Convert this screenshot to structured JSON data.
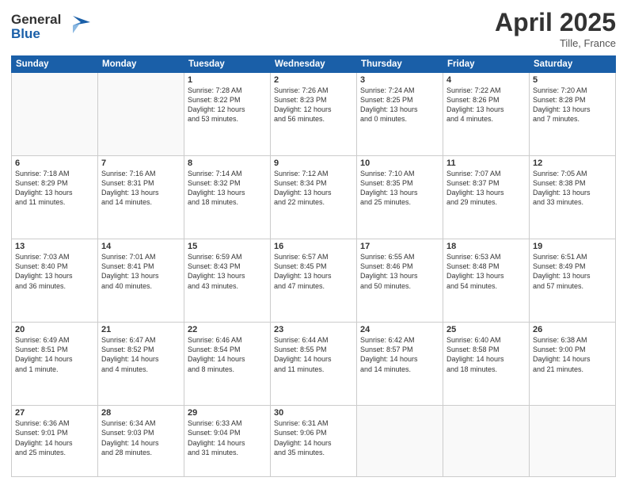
{
  "header": {
    "logo_line1": "General",
    "logo_line2": "Blue",
    "title": "April 2025",
    "location": "Tille, France"
  },
  "columns": [
    "Sunday",
    "Monday",
    "Tuesday",
    "Wednesday",
    "Thursday",
    "Friday",
    "Saturday"
  ],
  "weeks": [
    [
      {
        "day": "",
        "info": ""
      },
      {
        "day": "",
        "info": ""
      },
      {
        "day": "1",
        "info": "Sunrise: 7:28 AM\nSunset: 8:22 PM\nDaylight: 12 hours\nand 53 minutes."
      },
      {
        "day": "2",
        "info": "Sunrise: 7:26 AM\nSunset: 8:23 PM\nDaylight: 12 hours\nand 56 minutes."
      },
      {
        "day": "3",
        "info": "Sunrise: 7:24 AM\nSunset: 8:25 PM\nDaylight: 13 hours\nand 0 minutes."
      },
      {
        "day": "4",
        "info": "Sunrise: 7:22 AM\nSunset: 8:26 PM\nDaylight: 13 hours\nand 4 minutes."
      },
      {
        "day": "5",
        "info": "Sunrise: 7:20 AM\nSunset: 8:28 PM\nDaylight: 13 hours\nand 7 minutes."
      }
    ],
    [
      {
        "day": "6",
        "info": "Sunrise: 7:18 AM\nSunset: 8:29 PM\nDaylight: 13 hours\nand 11 minutes."
      },
      {
        "day": "7",
        "info": "Sunrise: 7:16 AM\nSunset: 8:31 PM\nDaylight: 13 hours\nand 14 minutes."
      },
      {
        "day": "8",
        "info": "Sunrise: 7:14 AM\nSunset: 8:32 PM\nDaylight: 13 hours\nand 18 minutes."
      },
      {
        "day": "9",
        "info": "Sunrise: 7:12 AM\nSunset: 8:34 PM\nDaylight: 13 hours\nand 22 minutes."
      },
      {
        "day": "10",
        "info": "Sunrise: 7:10 AM\nSunset: 8:35 PM\nDaylight: 13 hours\nand 25 minutes."
      },
      {
        "day": "11",
        "info": "Sunrise: 7:07 AM\nSunset: 8:37 PM\nDaylight: 13 hours\nand 29 minutes."
      },
      {
        "day": "12",
        "info": "Sunrise: 7:05 AM\nSunset: 8:38 PM\nDaylight: 13 hours\nand 33 minutes."
      }
    ],
    [
      {
        "day": "13",
        "info": "Sunrise: 7:03 AM\nSunset: 8:40 PM\nDaylight: 13 hours\nand 36 minutes."
      },
      {
        "day": "14",
        "info": "Sunrise: 7:01 AM\nSunset: 8:41 PM\nDaylight: 13 hours\nand 40 minutes."
      },
      {
        "day": "15",
        "info": "Sunrise: 6:59 AM\nSunset: 8:43 PM\nDaylight: 13 hours\nand 43 minutes."
      },
      {
        "day": "16",
        "info": "Sunrise: 6:57 AM\nSunset: 8:45 PM\nDaylight: 13 hours\nand 47 minutes."
      },
      {
        "day": "17",
        "info": "Sunrise: 6:55 AM\nSunset: 8:46 PM\nDaylight: 13 hours\nand 50 minutes."
      },
      {
        "day": "18",
        "info": "Sunrise: 6:53 AM\nSunset: 8:48 PM\nDaylight: 13 hours\nand 54 minutes."
      },
      {
        "day": "19",
        "info": "Sunrise: 6:51 AM\nSunset: 8:49 PM\nDaylight: 13 hours\nand 57 minutes."
      }
    ],
    [
      {
        "day": "20",
        "info": "Sunrise: 6:49 AM\nSunset: 8:51 PM\nDaylight: 14 hours\nand 1 minute."
      },
      {
        "day": "21",
        "info": "Sunrise: 6:47 AM\nSunset: 8:52 PM\nDaylight: 14 hours\nand 4 minutes."
      },
      {
        "day": "22",
        "info": "Sunrise: 6:46 AM\nSunset: 8:54 PM\nDaylight: 14 hours\nand 8 minutes."
      },
      {
        "day": "23",
        "info": "Sunrise: 6:44 AM\nSunset: 8:55 PM\nDaylight: 14 hours\nand 11 minutes."
      },
      {
        "day": "24",
        "info": "Sunrise: 6:42 AM\nSunset: 8:57 PM\nDaylight: 14 hours\nand 14 minutes."
      },
      {
        "day": "25",
        "info": "Sunrise: 6:40 AM\nSunset: 8:58 PM\nDaylight: 14 hours\nand 18 minutes."
      },
      {
        "day": "26",
        "info": "Sunrise: 6:38 AM\nSunset: 9:00 PM\nDaylight: 14 hours\nand 21 minutes."
      }
    ],
    [
      {
        "day": "27",
        "info": "Sunrise: 6:36 AM\nSunset: 9:01 PM\nDaylight: 14 hours\nand 25 minutes."
      },
      {
        "day": "28",
        "info": "Sunrise: 6:34 AM\nSunset: 9:03 PM\nDaylight: 14 hours\nand 28 minutes."
      },
      {
        "day": "29",
        "info": "Sunrise: 6:33 AM\nSunset: 9:04 PM\nDaylight: 14 hours\nand 31 minutes."
      },
      {
        "day": "30",
        "info": "Sunrise: 6:31 AM\nSunset: 9:06 PM\nDaylight: 14 hours\nand 35 minutes."
      },
      {
        "day": "",
        "info": ""
      },
      {
        "day": "",
        "info": ""
      },
      {
        "day": "",
        "info": ""
      }
    ]
  ]
}
